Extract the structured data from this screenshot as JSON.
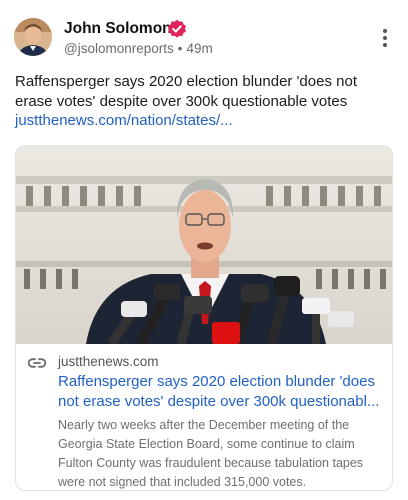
{
  "post": {
    "author_name": "John Solomon",
    "handle": "@jsolomonreports",
    "separator": "•",
    "time": "49m",
    "text": "Raffensperger says 2020 election blunder 'does not erase votes' despite over 300k questionable votes",
    "link_text": "justthenews.com/nation/states/..."
  },
  "link_preview": {
    "domain": "justthenews.com",
    "title": "Raffensperger says 2020 election blunder 'does not erase votes' despite over 300k questionabl...",
    "description": "Nearly two weeks after the December meeting of the Georgia State Election Board, some continue to claim Fulton County was fraudulent because tabulation tapes were not signed that included 315,000 votes."
  },
  "icons": {
    "verified": "verified-badge-icon",
    "more": "more-vertical-icon",
    "link": "link-icon"
  },
  "colors": {
    "link_blue": "#2160c4",
    "verified_pink": "#e0245e",
    "muted_text": "#6b6b70"
  }
}
